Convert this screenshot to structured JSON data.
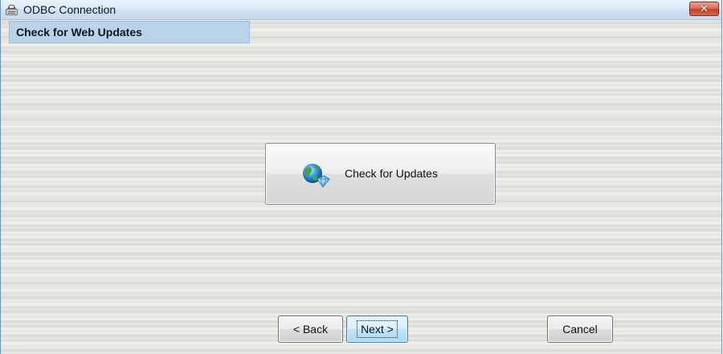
{
  "window": {
    "title": "ODBC Connection",
    "close_label": "✕",
    "app_icon": "odbc-app-icon"
  },
  "section": {
    "title": "Check for Web Updates"
  },
  "main": {
    "check_button_label": "Check for Updates",
    "check_button_icon": "globe-update-icon"
  },
  "footer": {
    "back_label": "< Back",
    "next_label": "Next >",
    "cancel_label": "Cancel"
  },
  "colors": {
    "section_header_bg": "#b9d3ea",
    "close_button": "#c74025",
    "next_focus_border": "#3c7fb1"
  }
}
